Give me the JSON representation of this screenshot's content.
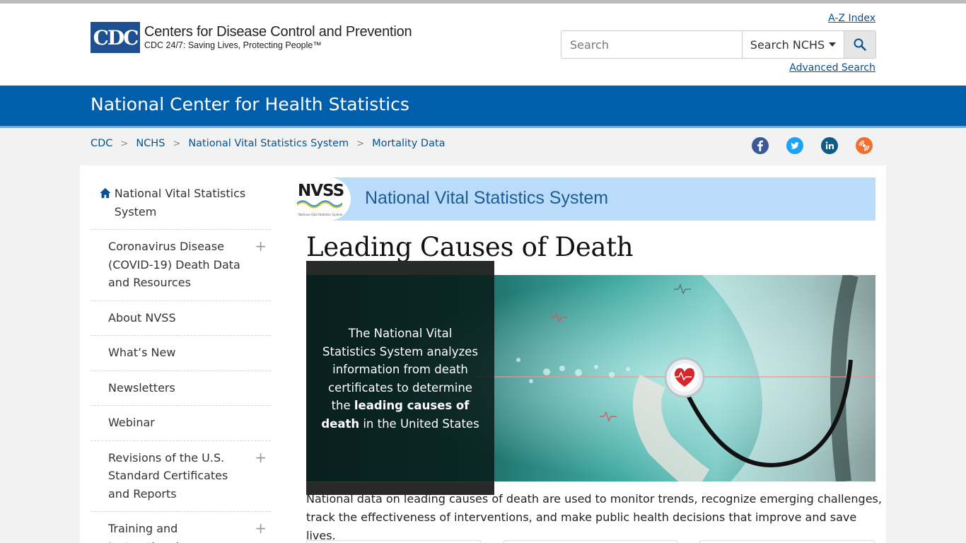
{
  "header": {
    "logo_box": "CDC",
    "logo_title": "Centers for Disease Control and Prevention",
    "logo_subtitle": "CDC 24/7: Saving Lives, Protecting People™",
    "az_index": "A-Z Index",
    "search_placeholder": "Search",
    "search_scope": "Search NCHS",
    "advanced_search": "Advanced Search"
  },
  "site": {
    "title": "National Center for Health Statistics"
  },
  "breadcrumb": [
    "CDC",
    "NCHS",
    "National Vital Statistics System",
    "Mortality Data"
  ],
  "social": {
    "facebook_color": "#3b5998",
    "twitter_color": "#1da1f2",
    "linkedin_color": "#0e5a8a",
    "syndicate_color": "#f2702d"
  },
  "sidenav": {
    "home": "National Vital Statistics System",
    "items": [
      {
        "label": "Coronavirus Disease (COVID-19) Death Data and Resources",
        "expandable": true
      },
      {
        "label": "About NVSS",
        "expandable": false
      },
      {
        "label": "What’s New",
        "expandable": false
      },
      {
        "label": "Newsletters",
        "expandable": false
      },
      {
        "label": "Webinar",
        "expandable": false
      },
      {
        "label": "Revisions of the U.S. Standard Certificates and Reports",
        "expandable": true
      },
      {
        "label": "Training and Instructional",
        "expandable": true
      }
    ]
  },
  "banner": {
    "logo_text": "NVSS",
    "logo_sub": "National Vital Statistics System",
    "title": "National Vital Statistics System"
  },
  "main": {
    "title": "Leading Causes of Death",
    "hero_pre": "The National Vital Statistics System analyzes information from death certificates to determine the",
    "hero_bold": "leading causes of death",
    "hero_post": "in the United States",
    "intro": "National data on leading causes of death are used to monitor trends, recognize emerging challenges, track the effectiveness of interventions, and make public health decisions that improve and save lives."
  }
}
